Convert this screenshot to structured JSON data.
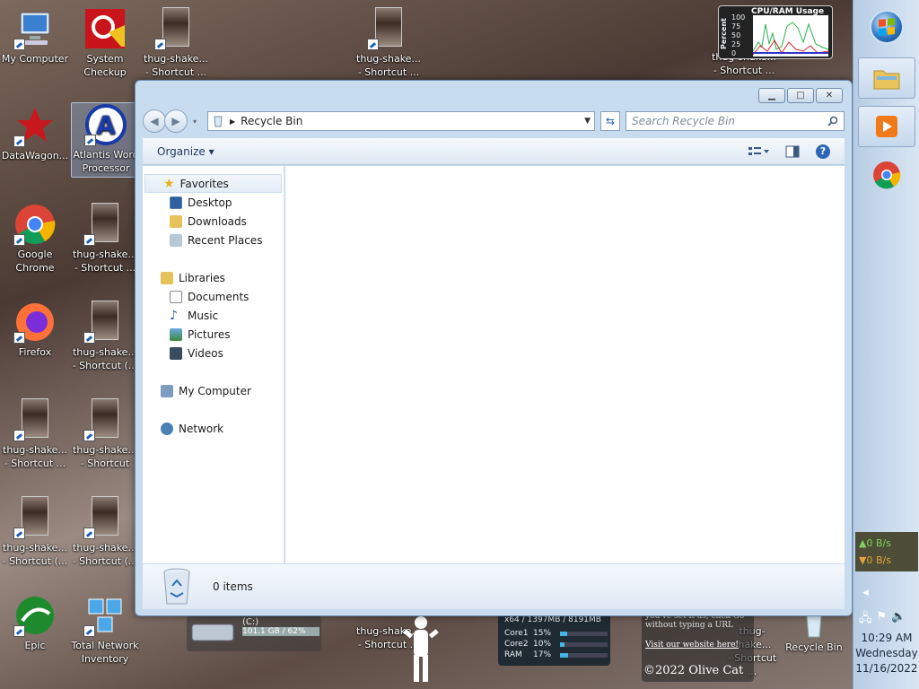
{
  "desktop": {
    "icons": [
      {
        "name": "my-computer",
        "label": "My Computer"
      },
      {
        "name": "system-checkup",
        "label": "System\nCheckup"
      },
      {
        "name": "thug-shake-1",
        "label": "thug-shake...\n- Shortcut ..."
      },
      {
        "name": "thug-shake-2",
        "label": "thug-shake...\n- Shortcut ..."
      },
      {
        "name": "thug-shake-3",
        "label": "thug-shake...\n- Shortcut ..."
      },
      {
        "name": "datawagon",
        "label": "DataWagon..."
      },
      {
        "name": "atlantis",
        "label": "Atlantis Word\nProcessor"
      },
      {
        "name": "chrome",
        "label": "Google\nChrome"
      },
      {
        "name": "thug-shake-4",
        "label": "thug-shake...\n- Shortcut ..."
      },
      {
        "name": "firefox",
        "label": "Firefox"
      },
      {
        "name": "thug-shake-5",
        "label": "thug-shake...\n- Shortcut (..."
      },
      {
        "name": "thug-shake-6",
        "label": "thug-shake...\n- Shortcut ..."
      },
      {
        "name": "thug-shake-7",
        "label": "thug-shake...\n- Shortcut"
      },
      {
        "name": "thug-shake-8",
        "label": "thug-shake...\n- Shortcut (..."
      },
      {
        "name": "thug-shake-9",
        "label": "thug-shake...\n- Shortcut (..."
      },
      {
        "name": "epic",
        "label": "Epic"
      },
      {
        "name": "total-network",
        "label": "Total Network\nInventory"
      },
      {
        "name": "thug-shake-10",
        "label": "thug-shake...\n- Shortcut ..."
      },
      {
        "name": "thug-shake-11",
        "label": "thug-shake...\n- Shortcut ..."
      },
      {
        "name": "recycle-bin",
        "label": "Recycle Bin"
      }
    ]
  },
  "gadgets": {
    "cpu_title": "CPU/RAM Usage",
    "cpu_axis": "Percent",
    "cpu_ticks": [
      "100",
      "75",
      "50",
      "25",
      "0"
    ],
    "drive_label": "(C:)",
    "drive_info": "101.1 GB / 62%",
    "mem_header": "x64 / 1397MB / 8191MB",
    "core1_label": "Core1",
    "core1_val": "15%",
    "core2_label": "Core2",
    "core2_val": "10%",
    "ram_label": "RAM",
    "ram_val": "17%",
    "olive_text": "you've set it as, click Go\nwithout typing a URL",
    "olive_link": "Visit our website here!",
    "olive_brand": "©2022 Olive Cat"
  },
  "explorer": {
    "address": "Recycle Bin",
    "search_placeholder": "Search Recycle Bin",
    "organize_label": "Organize ▾",
    "nav": {
      "favorites": "Favorites",
      "desktop": "Desktop",
      "downloads": "Downloads",
      "recent": "Recent Places",
      "libraries": "Libraries",
      "documents": "Documents",
      "music": "Music",
      "pictures": "Pictures",
      "videos": "Videos",
      "computer": "My Computer",
      "network": "Network"
    },
    "items_count": "0 items"
  },
  "taskbar": {
    "net_up": "▲0 B/s",
    "net_down": "▼0 B/s",
    "time": "10:29 AM",
    "day": "Wednesday",
    "date": "11/16/2022"
  },
  "colors": {
    "accent": "#2c67b7",
    "net_up": "#7fd35a",
    "net_down": "#e7a23a"
  }
}
